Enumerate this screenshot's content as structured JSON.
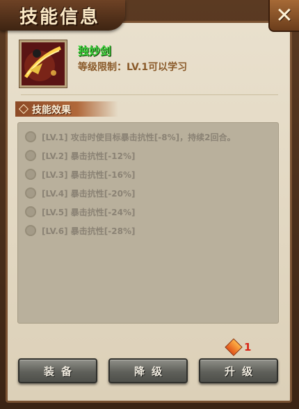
{
  "window": {
    "title": "技能信息",
    "close_icon": "close-x-icon"
  },
  "skill": {
    "name": "独妙剑",
    "requirement": "等级限制：LV.1可以学习",
    "icon": "sword-slash-icon"
  },
  "section": {
    "label": "技能效果"
  },
  "effects": [
    {
      "text": "[LV.1] 攻击时使目标暴击抗性[-8%]，持续2回合。"
    },
    {
      "text": "[LV.2] 暴击抗性[-12%]"
    },
    {
      "text": "[LV.3] 暴击抗性[-16%]"
    },
    {
      "text": "[LV.4] 暴击抗性[-20%]"
    },
    {
      "text": "[LV.5] 暴击抗性[-24%]"
    },
    {
      "text": "[LV.6] 暴击抗性[-28%]"
    }
  ],
  "cost": {
    "value": "1",
    "icon": "skill-point-gem-icon"
  },
  "buttons": {
    "equip": "装备",
    "downgrade": "降级",
    "upgrade": "升级"
  }
}
